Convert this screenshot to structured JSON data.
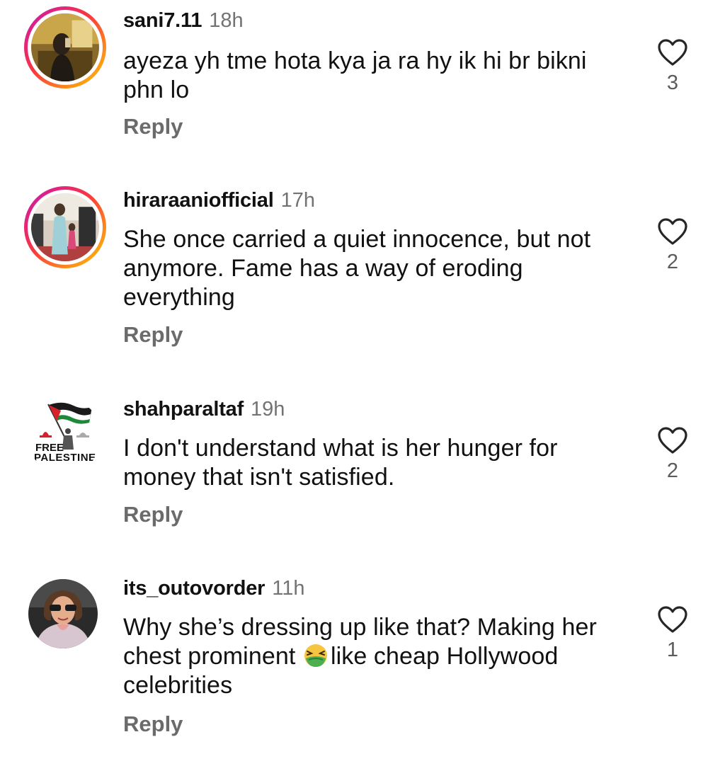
{
  "comments": [
    {
      "username": "sani7.11",
      "time": "18h",
      "text": "ayeza yh tme hota kya ja ra hy ik hi br bikni phn lo",
      "reply_label": "Reply",
      "likes": "3"
    },
    {
      "username": "hiraraaniofficial",
      "time": "17h",
      "text": "She once carried a quiet innocence, but not anymore. Fame has a way of eroding everything",
      "reply_label": "Reply",
      "likes": "2"
    },
    {
      "username": "shahparaltaf",
      "time": "19h",
      "text": "I don't understand what is her hunger for money that isn't satisfied.",
      "reply_label": "Reply",
      "likes": "2",
      "avatar_text": [
        "FREE",
        "PALESTINE"
      ]
    },
    {
      "username": "its_outovorder",
      "time": "11h",
      "text_before_emoji": "Why she’s dressing up like that? Making her chest prominent ",
      "text_after_emoji": "like cheap Hollywood celebrities",
      "emoji": "nauseated-face-emoji",
      "reply_label": "Reply",
      "likes": "1"
    }
  ],
  "icons": {
    "like": "heart-outline-icon"
  },
  "colors": {
    "story_ring_start": "#c913b9",
    "story_ring_mid": "#f9373f",
    "story_ring_end": "#fecd00",
    "secondary_text": "#737373"
  }
}
